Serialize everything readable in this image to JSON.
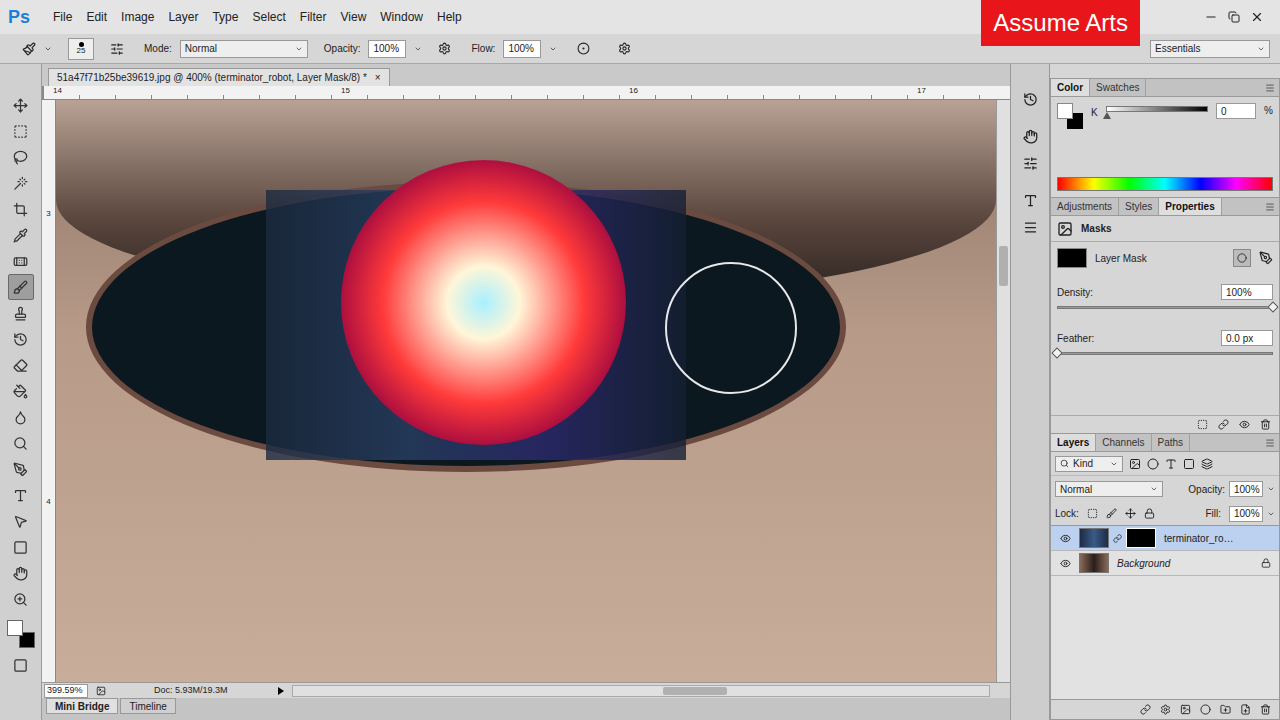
{
  "app": {
    "logo": "Ps",
    "menus": [
      "File",
      "Edit",
      "Image",
      "Layer",
      "Type",
      "Select",
      "Filter",
      "View",
      "Window",
      "Help"
    ],
    "watermark": "Assume Arts"
  },
  "options_bar": {
    "brush_size": "25",
    "mode_label": "Mode:",
    "mode": "Normal",
    "opacity_label": "Opacity:",
    "opacity": "100%",
    "flow_label": "Flow:",
    "flow": "100%"
  },
  "workspace": "Essentials",
  "tools": [
    {
      "selected": false
    },
    {
      "selected": false
    },
    {
      "selected": false
    },
    {
      "selected": false
    },
    {
      "selected": false
    },
    {
      "selected": false
    },
    {
      "selected": false
    },
    {
      "selected": true
    },
    {
      "selected": false
    },
    {
      "selected": false
    },
    {
      "selected": false
    },
    {
      "selected": false
    },
    {
      "selected": false
    },
    {
      "selected": false
    },
    {
      "selected": false
    },
    {
      "selected": false
    },
    {
      "selected": false
    },
    {
      "selected": false
    },
    {
      "selected": false
    },
    {
      "selected": false
    }
  ],
  "document": {
    "tab": "51a47f71b25be39619.jpg @ 400% (terminator_robot, Layer Mask/8) *",
    "close": "×",
    "ruler_top": [
      "14",
      "15",
      "16",
      "17"
    ],
    "ruler_left": [
      "3",
      "4"
    ]
  },
  "status": {
    "zoom": "399.59%",
    "doc": "Doc: 5.93M/19.3M"
  },
  "bottom_tabs": [
    {
      "label": "Mini Bridge",
      "selected": true
    },
    {
      "label": "Timeline",
      "selected": false
    }
  ],
  "color_panel": {
    "tabs": [
      {
        "label": "Color",
        "selected": true
      },
      {
        "label": "Swatches",
        "selected": false
      }
    ],
    "channel": "K",
    "value": "0",
    "unit": "%",
    "level": 0
  },
  "properties_panel": {
    "tabs": [
      {
        "label": "Adjustments",
        "selected": false
      },
      {
        "label": "Styles",
        "selected": false
      },
      {
        "label": "Properties",
        "selected": true
      }
    ],
    "section": "Masks",
    "mask_label": "Layer Mask",
    "density_label": "Density:",
    "density": "100%",
    "density_level": 1,
    "feather_label": "Feather:",
    "feather": "0.0 px",
    "feather_level": 0
  },
  "layers_panel": {
    "tabs": [
      {
        "label": "Layers",
        "selected": true
      },
      {
        "label": "Channels",
        "selected": false
      },
      {
        "label": "Paths",
        "selected": false
      }
    ],
    "filter": "Kind",
    "blend": "Normal",
    "opacity_label": "Opacity:",
    "opacity": "100%",
    "lock_label": "Lock:",
    "fill_label": "Fill:",
    "fill": "100%",
    "layers": [
      {
        "name": "terminator_ro…",
        "visible": true,
        "selected": true,
        "locked": false,
        "has_mask": true,
        "italic": false
      },
      {
        "name": "Background",
        "visible": true,
        "selected": false,
        "locked": true,
        "has_mask": false,
        "italic": true
      }
    ]
  }
}
